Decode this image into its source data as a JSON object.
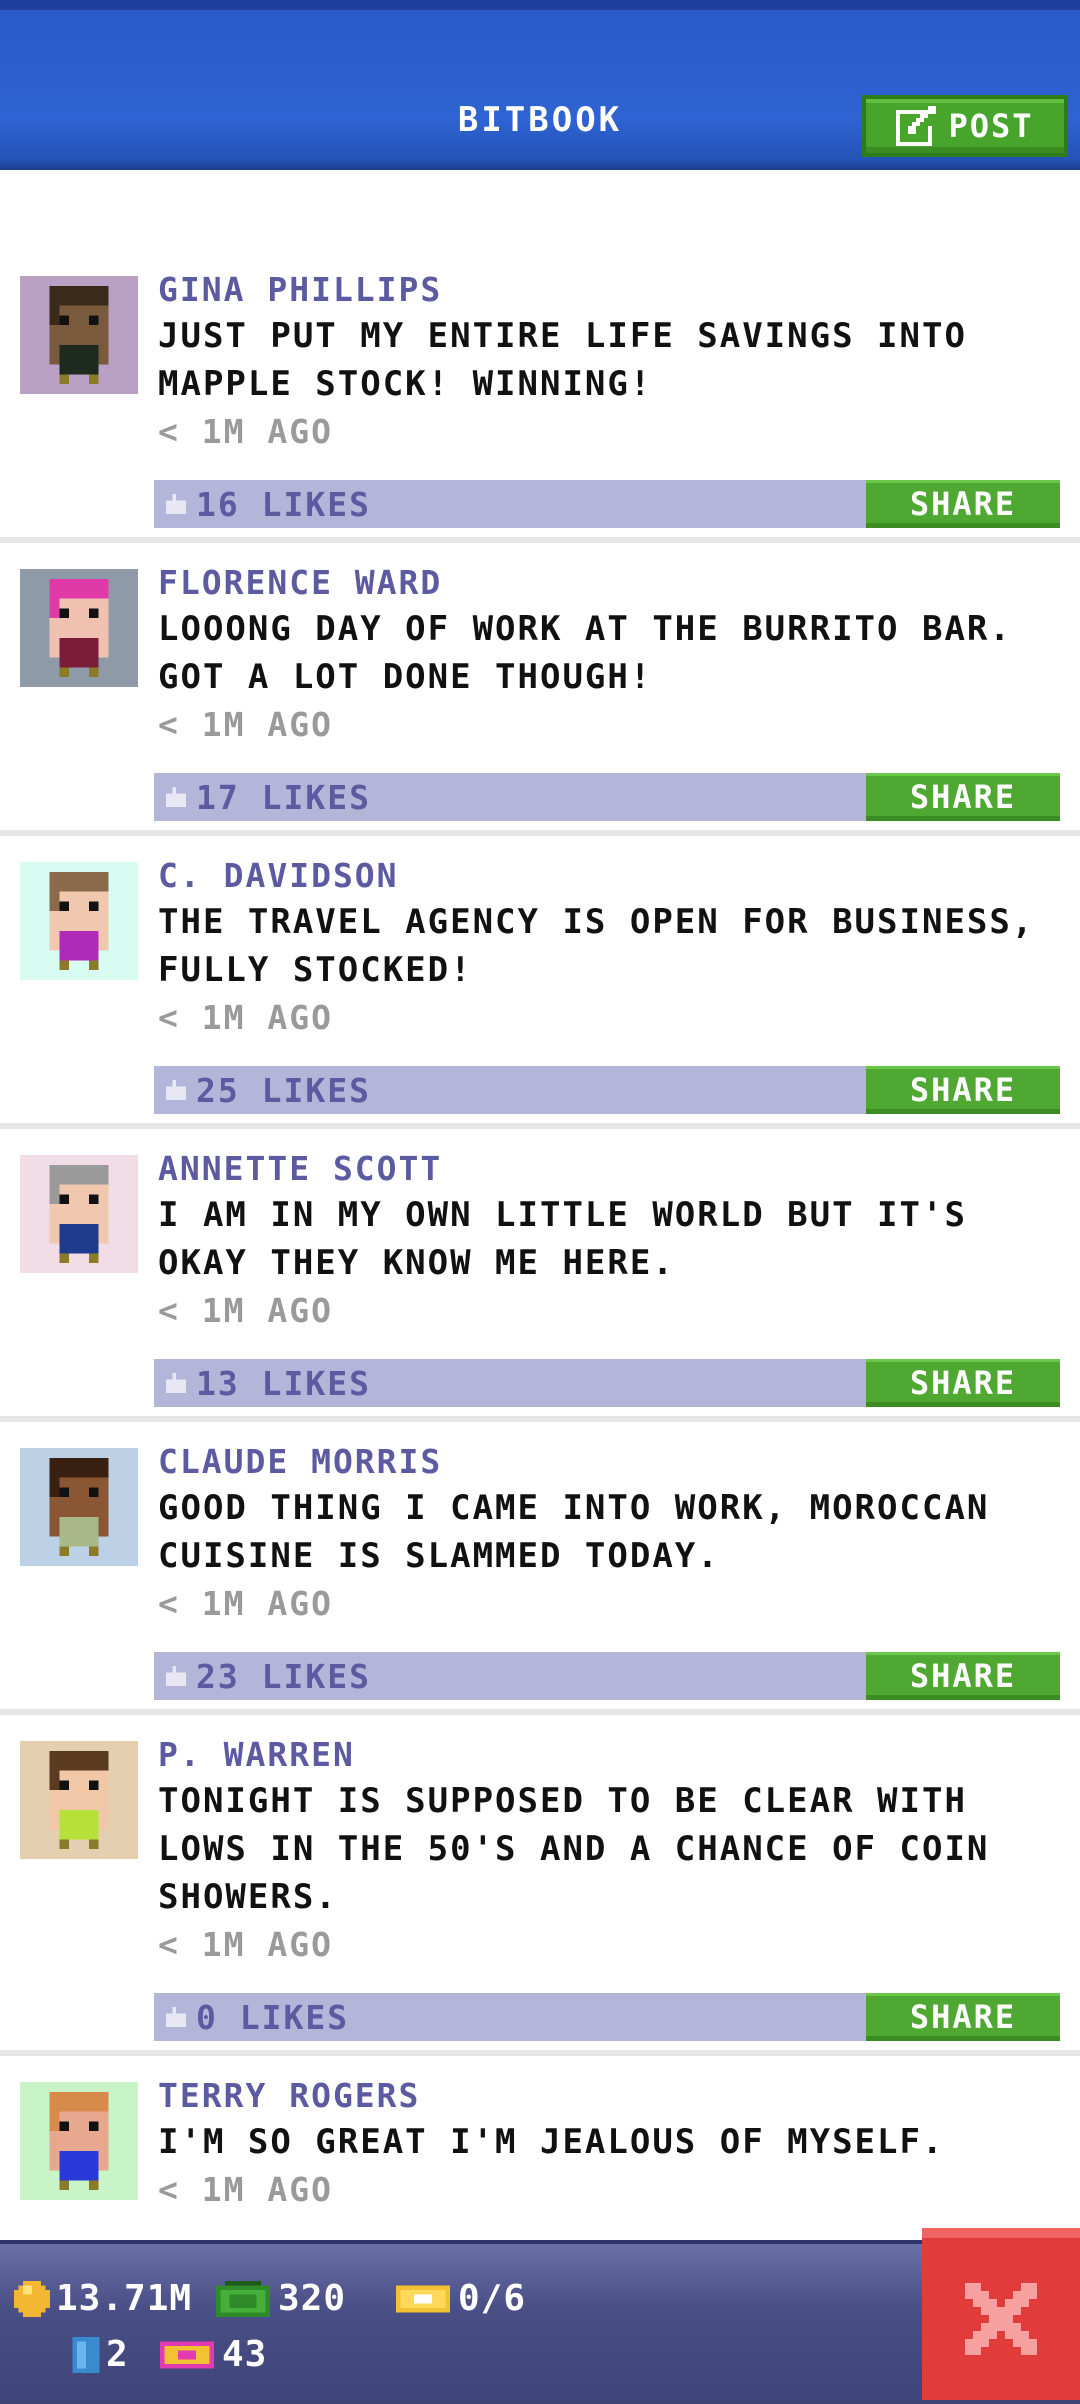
{
  "header": {
    "title": "BITBOOK",
    "post_label": "POST"
  },
  "posts": [
    {
      "name": "GINA PHILLIPS",
      "message": "JUST PUT MY ENTIRE LIFE SAVINGS INTO MAPPLE STOCK! WINNING!",
      "time": "< 1M AGO",
      "likes": "16 LIKES",
      "share": "SHARE",
      "avatar_bg": "#b9a0c4",
      "skin": "#7a5a3c",
      "hair": "#3a2a1a",
      "shirt": "#1e2a1e"
    },
    {
      "name": "FLORENCE WARD",
      "message": "LOOONG DAY OF WORK AT THE BURRITO BAR. GOT A LOT DONE THOUGH!",
      "time": "< 1M AGO",
      "likes": "17 LIKES",
      "share": "SHARE",
      "avatar_bg": "#8f9aa8",
      "skin": "#f0c0b0",
      "hair": "#e03aa8",
      "shirt": "#7a1c3a"
    },
    {
      "name": "C. DAVIDSON",
      "message": "THE TRAVEL AGENCY IS OPEN FOR BUSINESS, FULLY STOCKED!",
      "time": "< 1M AGO",
      "likes": "25 LIKES",
      "share": "SHARE",
      "avatar_bg": "#d8fbf2",
      "skin": "#f0c8b0",
      "hair": "#8a6a4a",
      "shirt": "#b02ab8"
    },
    {
      "name": "ANNETTE SCOTT",
      "message": "I AM IN MY OWN LITTLE WORLD BUT IT'S OKAY THEY KNOW ME HERE.",
      "time": "< 1M AGO",
      "likes": "13 LIKES",
      "share": "SHARE",
      "avatar_bg": "#f2dce6",
      "skin": "#f0c8b0",
      "hair": "#9a9a9a",
      "shirt": "#1e3a8a"
    },
    {
      "name": "CLAUDE MORRIS",
      "message": "GOOD THING I CAME INTO WORK, MOROCCAN CUISINE IS SLAMMED TODAY.",
      "time": "< 1M AGO",
      "likes": "23 LIKES",
      "share": "SHARE",
      "avatar_bg": "#bcd0e6",
      "skin": "#8a5634",
      "hair": "#3a2010",
      "shirt": "#a8b888"
    },
    {
      "name": "P. WARREN",
      "message": "TONIGHT IS SUPPOSED TO BE CLEAR WITH LOWS IN THE 50'S AND A CHANCE OF COIN SHOWERS.",
      "time": "< 1M AGO",
      "likes": "0 LIKES",
      "share": "SHARE",
      "avatar_bg": "#e4d0b0",
      "skin": "#f0c8a8",
      "hair": "#5a3a20",
      "shirt": "#b8e03a"
    },
    {
      "name": "TERRY ROGERS",
      "message": "I'M SO GREAT I'M JEALOUS OF MYSELF.",
      "time": "< 1M AGO",
      "likes": "",
      "share": "",
      "avatar_bg": "#c8f4c8",
      "skin": "#e8a890",
      "hair": "#d88a4a",
      "shirt": "#2a3ad8"
    }
  ],
  "stats": {
    "coins": "13.71M",
    "bux": "320",
    "tickets": "0/6",
    "elevators": "2",
    "vip": "43"
  },
  "colors": {
    "accent_green": "#4ea832",
    "header_blue": "#2f63d2",
    "name_purple": "#5c5aa0",
    "close_red": "#e13b3b"
  }
}
